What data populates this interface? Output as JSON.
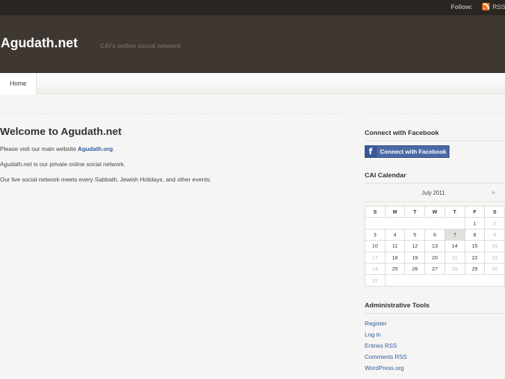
{
  "topbar": {
    "follow_label": "Follow:",
    "rss_label": "RSS",
    "rss_icon": "rss-icon"
  },
  "header": {
    "site_title": "Agudath.net",
    "tagline": "CAI's online social network"
  },
  "nav": {
    "items": [
      {
        "label": "Home"
      }
    ]
  },
  "main": {
    "title": "Welcome to Agudath.net",
    "p1_text": "Please visit our main website ",
    "p1_link": "Agudath.org",
    "p1_end": ".",
    "p2_text": "Agudath.net is our private online social network.",
    "p3_text": "Our live social network meets every Sabbath, Jewish Holidays, and other events."
  },
  "sidebar": {
    "facebook": {
      "title": "Connect with Facebook",
      "button_label": "Connect with Facebook",
      "icon": "facebook-icon"
    },
    "calendar": {
      "title": "CAI Calendar",
      "caption": "July  2011",
      "next": "»",
      "weekdays": [
        "S",
        "M",
        "T",
        "W",
        "T",
        "F",
        "S"
      ],
      "weeks": [
        [
          "",
          "",
          "",
          "",
          "",
          "1",
          "2"
        ],
        [
          "3",
          "4",
          "5",
          "6",
          "7",
          "8",
          "9"
        ],
        [
          "10",
          "11",
          "12",
          "13",
          "14",
          "15",
          "16"
        ],
        [
          "17",
          "18",
          "19",
          "20",
          "21",
          "22",
          "23"
        ],
        [
          "24",
          "25",
          "26",
          "27",
          "28",
          "29",
          "30"
        ],
        [
          "31",
          "",
          "",
          "",
          "",
          "",
          ""
        ]
      ],
      "today": "7"
    },
    "admin": {
      "title": "Administrative Tools",
      "links": [
        "Register",
        "Log in",
        "Entries RSS",
        "Comments RSS",
        "WordPress.org"
      ]
    }
  },
  "colors": {
    "accent_link": "#2c5aa0",
    "facebook_blue": "#4a6aa5",
    "rss_orange": "#e86f1c",
    "header_bg": "#3c3530"
  }
}
